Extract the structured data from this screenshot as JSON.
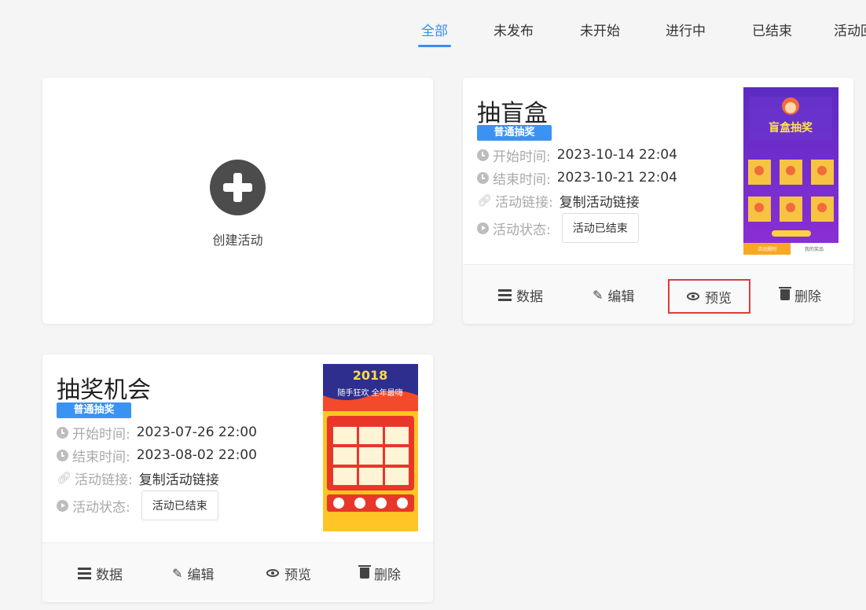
{
  "tabs": [
    {
      "label": "全部",
      "active": true
    },
    {
      "label": "未发布"
    },
    {
      "label": "未开始"
    },
    {
      "label": "进行中"
    },
    {
      "label": "已结束"
    },
    {
      "label": "活动回"
    }
  ],
  "create": {
    "label": "创建活动",
    "icon": "plus-circle-icon"
  },
  "labels": {
    "start": "开始时间:",
    "end": "结束时间:",
    "link": "活动链接:",
    "status": "活动状态:",
    "copy_link": "复制活动链接"
  },
  "actions": {
    "data": "数据",
    "edit": "编辑",
    "preview": "预览",
    "delete": "删除"
  },
  "activities": [
    {
      "title": "抽盲盒",
      "type": "普通抽奖",
      "start": "2023-10-14 22:04",
      "end": "2023-10-21 22:04",
      "status": "活动已结束",
      "thumb_text": "盲盒抽奖",
      "thumb_bar_left": "活动规则",
      "thumb_bar_right": "我的奖品"
    },
    {
      "title": "抽奖机会",
      "type": "普通抽奖",
      "start": "2023-07-26 22:00",
      "end": "2023-08-02 22:00",
      "status": "活动已结束",
      "thumb_year": "2018",
      "thumb_text": "随手狂欢 全年最嗨"
    }
  ],
  "colors": {
    "accent": "#3d8cf0",
    "badge": "#3a93f2",
    "highlight": "#e03b3b"
  }
}
